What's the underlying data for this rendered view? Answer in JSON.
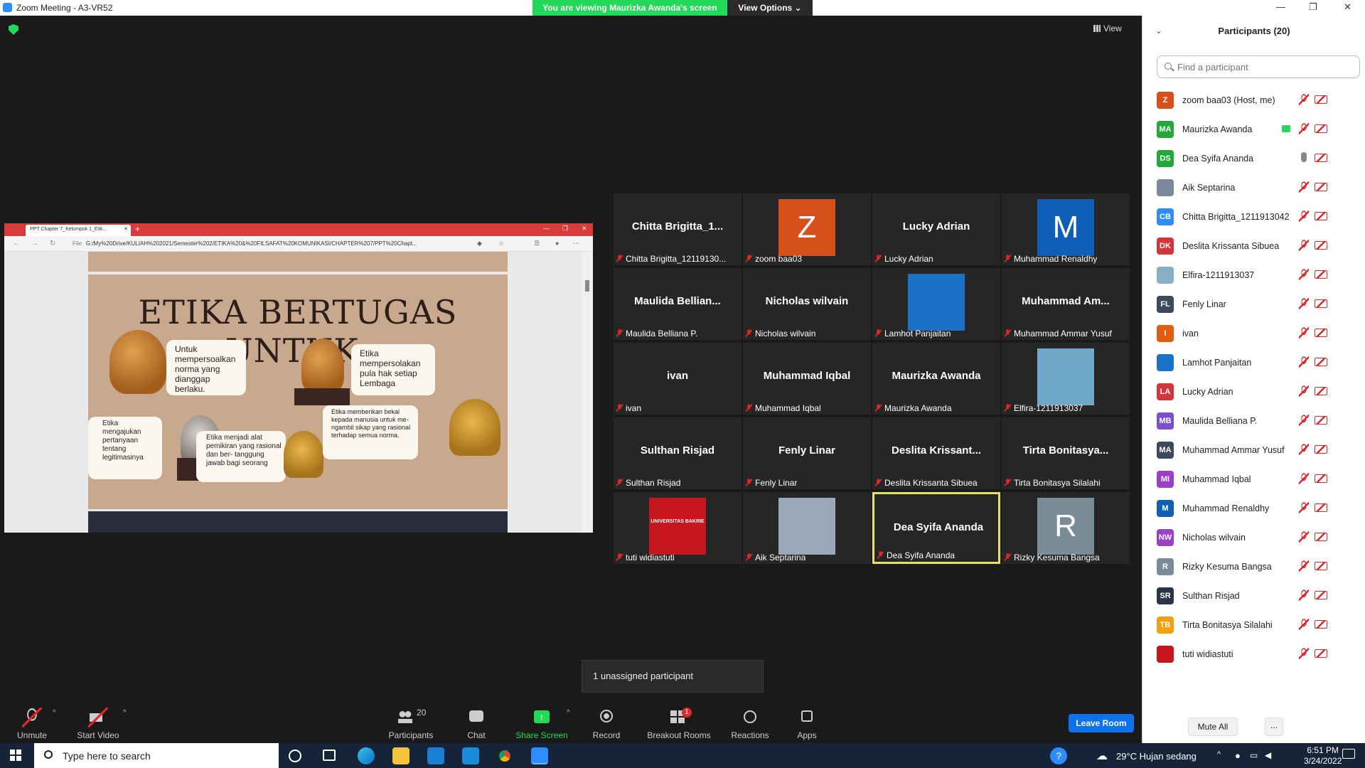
{
  "window": {
    "title": "Zoom Meeting - A3-VR52",
    "share_banner": "You are viewing Maurizka Awanda's screen",
    "view_options": "View Options ⌄",
    "view_label": "View",
    "minimize": "—",
    "maximize": "❐",
    "close": "✕"
  },
  "shared_screen": {
    "tab_title": "PPT Chapter 7_Kelompok 1_Etik...",
    "tab_close": "✕",
    "new_tab": "+",
    "url_prefix": "File",
    "url": "G:/My%20Drive/KULIAH%202021/Semester%202/ETIKA%20&%20FILSAFAT%20KOMUNIKASI/CHAPTER%207/PPT%20Chapt...",
    "slide": {
      "title": "ETIKA BERTUGAS UNTUK:",
      "points": [
        "Untuk mempersoalkan norma yang dianggap berlaku.",
        "Etika mempersolakan pula hak setiap Lembaga",
        "Etika mengajukan pertanyaan tentang legitimasinya",
        "Etika menjadi alat pemikiran yang rasional dan ber- tanggung jawab bagi seorang",
        "Etika memberikan bekal kepada manusia untuk me- ngambil sikap yang rasional terhadap semua norma."
      ]
    }
  },
  "gallery": [
    {
      "name": "Chitta Brigitta_1...",
      "label": "Chitta Brigitta_12119130...",
      "type": "name"
    },
    {
      "name": "",
      "label": "zoom baa03",
      "type": "avatar",
      "avatar_letter": "Z",
      "avatar_color": "#d74f1b"
    },
    {
      "name": "Lucky Adrian",
      "label": "Lucky Adrian",
      "type": "name"
    },
    {
      "name": "",
      "label": "Muhammad Renaldhy",
      "type": "avatar",
      "avatar_letter": "M",
      "avatar_color": "#0e5fb5"
    },
    {
      "name": "Maulida Bellian...",
      "label": "Maulida Belliana P.",
      "type": "name"
    },
    {
      "name": "Nicholas wilvain",
      "label": "Nicholas wilvain",
      "type": "name"
    },
    {
      "name": "",
      "label": "Lamhot Panjaitan",
      "type": "photo",
      "photo_color": "#1a73c9"
    },
    {
      "name": "Muhammad Am...",
      "label": "Muhammad Ammar Yusuf",
      "type": "name"
    },
    {
      "name": "ivan",
      "label": "ivan",
      "type": "name"
    },
    {
      "name": "Muhammad Iqbal",
      "label": "Muhammad Iqbal",
      "type": "name"
    },
    {
      "name": "Maurizka Awanda",
      "label": "Maurizka Awanda",
      "type": "name"
    },
    {
      "name": "",
      "label": "Elfira-1211913037",
      "type": "photo",
      "photo_color": "#6fa8c8"
    },
    {
      "name": "Sulthan Risjad",
      "label": "Sulthan Risjad",
      "type": "name"
    },
    {
      "name": "Fenly Linar",
      "label": "Fenly Linar",
      "type": "name"
    },
    {
      "name": "Deslita Krissant...",
      "label": "Deslita Krissanta Sibuea",
      "type": "name"
    },
    {
      "name": "Tirta Bonitasya...",
      "label": "Tirta Bonitasya Silalahi",
      "type": "name"
    },
    {
      "name": "",
      "label": "tuti widiastuti",
      "type": "logo",
      "photo_text": "UNIVERSITAS BAKRIE",
      "photo_color": "#c8161d"
    },
    {
      "name": "",
      "label": "Aik Septarina",
      "type": "photo",
      "photo_color": "#9aa7b8"
    },
    {
      "name": "Dea Syifa Ananda",
      "label": "Dea Syifa Ananda",
      "type": "name",
      "active": true
    },
    {
      "name": "",
      "label": "Rizky Kesuma Bangsa",
      "type": "avatar",
      "avatar_letter": "R",
      "avatar_color": "#7b8c99"
    }
  ],
  "notice": "1 unassigned participant",
  "toolbar": {
    "unmute": "Unmute",
    "start_video": "Start Video",
    "participants": "Participants",
    "participants_count": "20",
    "chat": "Chat",
    "share_screen": "Share Screen",
    "record": "Record",
    "breakout_rooms": "Breakout Rooms",
    "breakout_badge": "1",
    "reactions": "Reactions",
    "apps": "Apps",
    "leave_room": "Leave Room"
  },
  "panel": {
    "title": "Participants (20)",
    "search_placeholder": "Find a participant",
    "mute_all": "Mute All",
    "more": "...",
    "participants": [
      {
        "initials": "Z",
        "name": "zoom baa03 (Host, me)",
        "color": "#d74f1b"
      },
      {
        "initials": "MA",
        "name": "Maurizka Awanda",
        "color": "#23a83a",
        "sharing": true
      },
      {
        "initials": "DS",
        "name": "Dea Syifa Ananda",
        "color": "#23a83a",
        "mic_on": true
      },
      {
        "initials": "",
        "name": "Aik Septarina",
        "color": "#7c8aa0"
      },
      {
        "initials": "CB",
        "name": "Chitta Brigitta_1211913042",
        "color": "#2d8cff"
      },
      {
        "initials": "DK",
        "name": "Deslita Krissanta Sibuea",
        "color": "#d4343a"
      },
      {
        "initials": "",
        "name": "Elfira-1211913037",
        "color": "#8ab0c8"
      },
      {
        "initials": "FL",
        "name": "Fenly Linar",
        "color": "#3d4a5c"
      },
      {
        "initials": "I",
        "name": "ivan",
        "color": "#e35d10"
      },
      {
        "initials": "",
        "name": "Lamhot Panjaitan",
        "color": "#1a73c9"
      },
      {
        "initials": "LA",
        "name": "Lucky Adrian",
        "color": "#d4343a"
      },
      {
        "initials": "MB",
        "name": "Maulida Belliana P.",
        "color": "#7b4fd1"
      },
      {
        "initials": "MA",
        "name": "Muhammad Ammar Yusuf",
        "color": "#3d4a5c"
      },
      {
        "initials": "MI",
        "name": "Muhammad Iqbal",
        "color": "#9b3fc8"
      },
      {
        "initials": "M",
        "name": "Muhammad Renaldhy",
        "color": "#0e5fb5"
      },
      {
        "initials": "NW",
        "name": "Nicholas wilvain",
        "color": "#9b3fc8"
      },
      {
        "initials": "R",
        "name": "Rizky Kesuma Bangsa",
        "color": "#7b8c99"
      },
      {
        "initials": "SR",
        "name": "Sulthan Risjad",
        "color": "#2a3648"
      },
      {
        "initials": "TB",
        "name": "Tirta Bonitasya Silalahi",
        "color": "#f2a10c"
      },
      {
        "initials": "",
        "name": "tuti widiastuti",
        "color": "#c8161d"
      }
    ]
  },
  "taskbar": {
    "search_placeholder": "Type here to search",
    "weather": "29°C  Hujan sedang",
    "time": "6:51 PM",
    "date": "3/24/2022"
  }
}
